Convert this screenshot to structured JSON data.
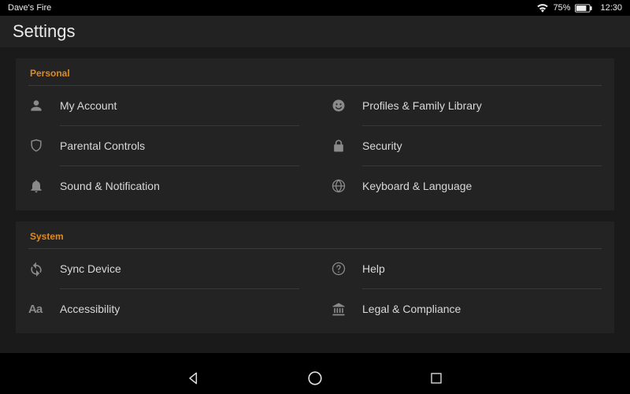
{
  "statusbar": {
    "device_name": "Dave's Fire",
    "wifi_icon": "wifi",
    "battery_percent": "75%",
    "battery_icon": "battery",
    "time": "12:30"
  },
  "header": {
    "title": "Settings"
  },
  "sections": {
    "personal": {
      "title": "Personal",
      "items": {
        "my_account": "My Account",
        "profiles_family": "Profiles & Family Library",
        "parental_controls": "Parental Controls",
        "security": "Security",
        "sound_notification": "Sound & Notification",
        "keyboard_language": "Keyboard & Language"
      }
    },
    "system": {
      "title": "System",
      "items": {
        "sync_device": "Sync Device",
        "help": "Help",
        "accessibility": "Accessibility",
        "legal_compliance": "Legal & Compliance"
      }
    }
  },
  "navbar": {
    "back": "Back",
    "home": "Home",
    "recent": "Recent"
  }
}
